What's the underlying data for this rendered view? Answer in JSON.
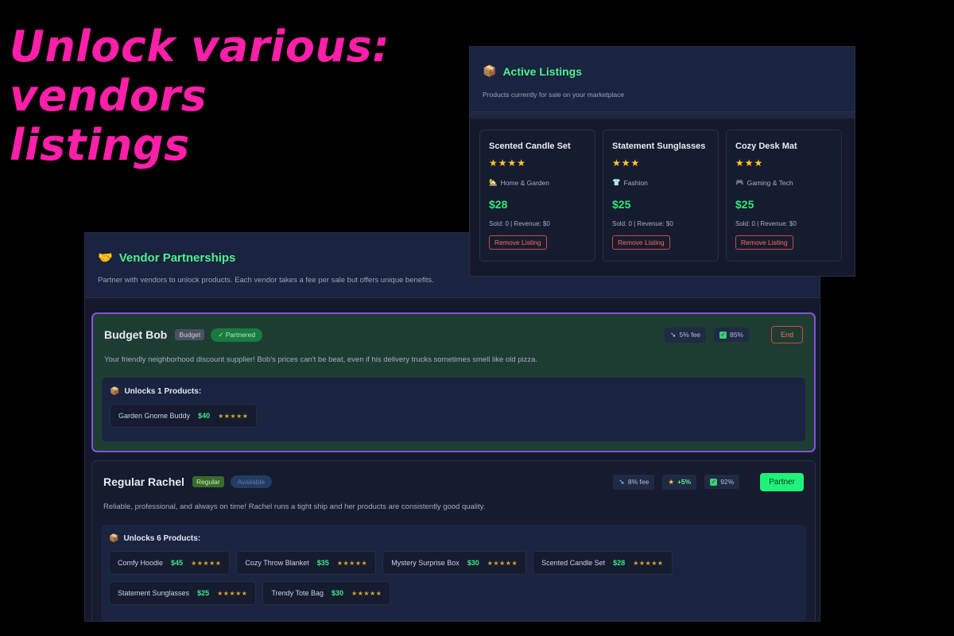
{
  "headline": {
    "line1": "Unlock various:",
    "line2": "vendors",
    "line3": "listings"
  },
  "listings": {
    "icon": "📦",
    "title": "Active Listings",
    "subtitle": "Products currently for sale on your marketplace",
    "items": [
      {
        "name": "Scented Candle Set",
        "stars": "★★★★",
        "category_icon": "🏡",
        "category": "Home & Garden",
        "price": "$28",
        "stats": "Sold: 0 | Revenue: $0",
        "remove_label": "Remove Listing"
      },
      {
        "name": "Statement Sunglasses",
        "stars": "★★★",
        "category_icon": "👕",
        "category": "Fashion",
        "price": "$25",
        "stats": "Sold: 0 | Revenue: $0",
        "remove_label": "Remove Listing"
      },
      {
        "name": "Cozy Desk Mat",
        "stars": "★★★",
        "category_icon": "🎮",
        "category": "Gaming & Tech",
        "price": "$25",
        "stats": "Sold: 0 | Revenue: $0",
        "remove_label": "Remove Listing"
      }
    ]
  },
  "vendors": {
    "icon": "🤝",
    "title": "Vendor Partnerships",
    "subtitle": "Partner with vendors to unlock products. Each vendor takes a fee per sale but offers unique benefits.",
    "list": [
      {
        "name": "Budget Bob",
        "tier": "Budget",
        "status": "✓ Partnered",
        "fee": "5% fee",
        "reliability": "85%",
        "action_label": "End",
        "description": "Your friendly neighborhood discount supplier! Bob's prices can't be beat, even if his delivery trucks sometimes smell like old pizza.",
        "unlocks_title": "Unlocks 1 Products:",
        "products": [
          {
            "name": "Garden Gnome Buddy",
            "price": "$40",
            "stars": "★★★★★"
          }
        ]
      },
      {
        "name": "Regular Rachel",
        "tier": "Regular",
        "status": "Available",
        "fee": "8% fee",
        "bonus": "+5%",
        "reliability": "92%",
        "action_label": "Partner",
        "description": "Reliable, professional, and always on time! Rachel runs a tight ship and her products are consistently good quality.",
        "unlocks_title": "Unlocks 6 Products:",
        "products": [
          {
            "name": "Comfy Hoodie",
            "price": "$45",
            "stars": "★★★★★"
          },
          {
            "name": "Cozy Throw Blanket",
            "price": "$35",
            "stars": "★★★★★"
          },
          {
            "name": "Mystery Surprise Box",
            "price": "$30",
            "stars": "★★★★★"
          },
          {
            "name": "Scented Candle Set",
            "price": "$28",
            "stars": "★★★★★"
          },
          {
            "name": "Statement Sunglasses",
            "price": "$25",
            "stars": "★★★★★"
          },
          {
            "name": "Trendy Tote Bag",
            "price": "$30",
            "stars": "★★★★★"
          }
        ]
      }
    ]
  },
  "colors": {
    "accent_green": "#4cf08a",
    "headline_pink": "#ff1fa8",
    "panel_bg": "#141a2b",
    "partner_button": "#1ff27a",
    "danger": "#ff6a5a"
  }
}
